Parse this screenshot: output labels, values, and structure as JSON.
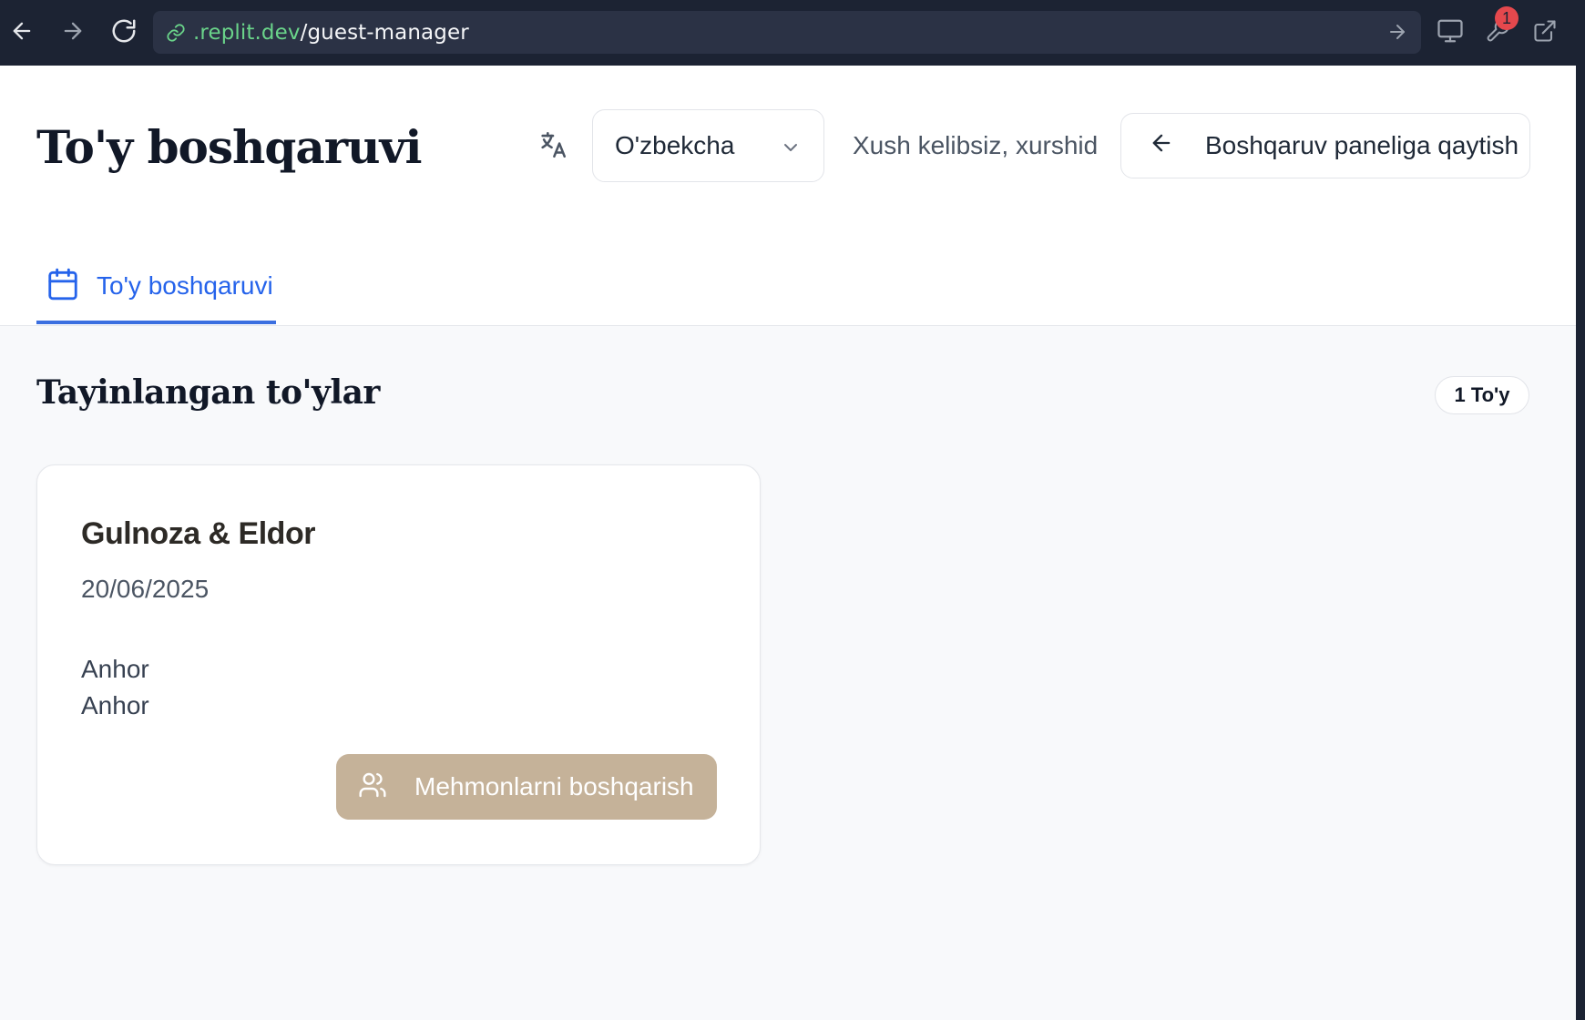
{
  "browser": {
    "url_host": ".replit.dev",
    "url_path": "/guest-manager",
    "notification_count": "1"
  },
  "header": {
    "title": "To'y boshqaruvi",
    "language_selected": "O'zbekcha",
    "welcome_text": "Xush kelibsiz, xurshid",
    "back_button_label": "Boshqaruv paneliga qaytish"
  },
  "tabs": [
    {
      "label": "To'y boshqaruvi",
      "active": true
    }
  ],
  "section": {
    "title": "Tayinlangan to'ylar",
    "count_label": "1 To'y"
  },
  "weddings": [
    {
      "couple": "Gulnoza & Eldor",
      "date": "20/06/2025",
      "venue_line1": "Anhor",
      "venue_line2": "Anhor",
      "action_label": "Mehmonlarni boshqarish"
    }
  ],
  "colors": {
    "accent_blue": "#2563eb",
    "action_button": "#c5b299",
    "chrome_bg": "#1c2333",
    "url_host": "#6ad48a",
    "badge": "#e5484d"
  }
}
